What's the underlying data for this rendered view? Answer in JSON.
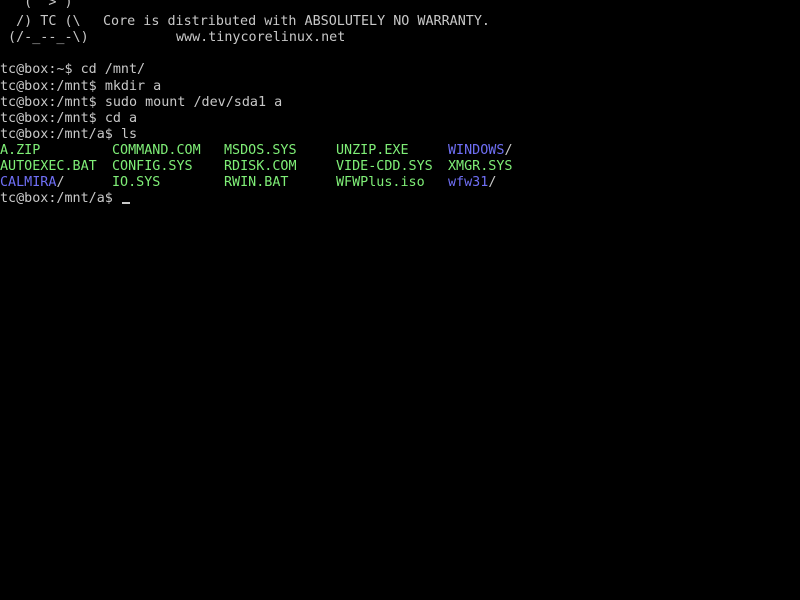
{
  "banner": {
    "art_line1": "   ( '>')",
    "art_line2": "  /) TC (\\",
    "art_line3": " (/-_--_-\\)",
    "message": "Core is distributed with ABSOLUTELY NO WARRANTY.",
    "url": "www.tinycorelinux.net"
  },
  "history": [
    {
      "prompt": "tc@box:~$",
      "command": "cd /mnt/"
    },
    {
      "prompt": "tc@box:/mnt$",
      "command": "mkdir a"
    },
    {
      "prompt": "tc@box:/mnt$",
      "command": "sudo mount /dev/sda1 a"
    },
    {
      "prompt": "tc@box:/mnt$",
      "command": "cd a"
    },
    {
      "prompt": "tc@box:/mnt/a$",
      "command": "ls"
    }
  ],
  "listing": {
    "file_color": "#7fee77",
    "dir_color": "#6f6ff5",
    "rows": [
      [
        "A.ZIP",
        "COMMAND.COM",
        "MSDOS.SYS",
        "UNZIP.EXE",
        "WINDOWS"
      ],
      [
        "AUTOEXEC.BAT",
        "CONFIG.SYS",
        "RDISK.COM",
        "VIDE-CDD.SYS",
        "XMGR.SYS"
      ],
      [
        "CALMIRA",
        "IO.SYS",
        "RWIN.BAT",
        "WFWPlus.iso",
        "wfw31"
      ]
    ],
    "dir_suffix": "/"
  },
  "current_prompt": {
    "prompt": "tc@box:/mnt/a$",
    "input": ""
  }
}
